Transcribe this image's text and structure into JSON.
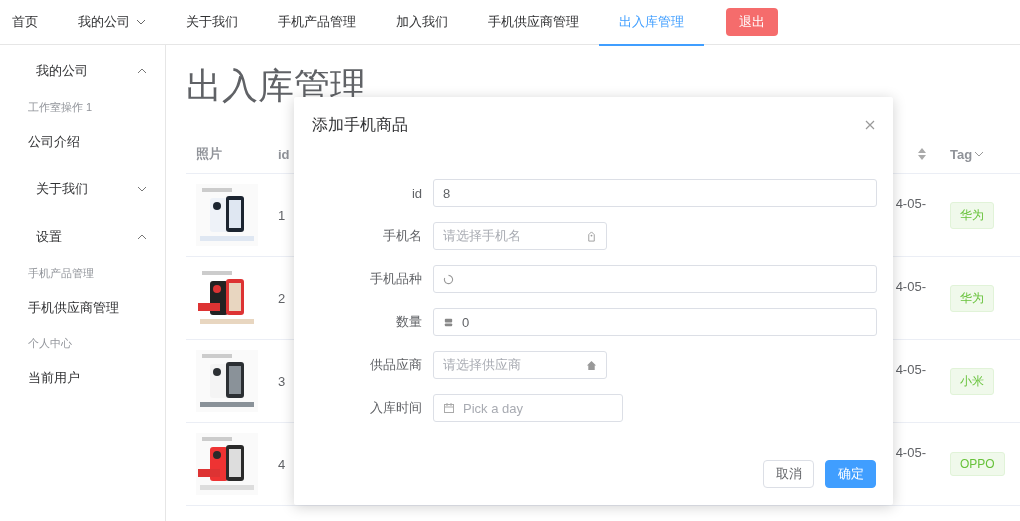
{
  "nav": {
    "items": [
      {
        "label": "首页",
        "selected": false,
        "dropdown": false
      },
      {
        "label": "我的公司",
        "selected": false,
        "dropdown": true
      },
      {
        "label": "关于我们",
        "selected": false,
        "dropdown": false
      },
      {
        "label": "手机产品管理",
        "selected": false,
        "dropdown": false
      },
      {
        "label": "加入我们",
        "selected": false,
        "dropdown": false
      },
      {
        "label": "手机供应商管理",
        "selected": false,
        "dropdown": false
      },
      {
        "label": "出入库管理",
        "selected": true,
        "dropdown": false
      }
    ],
    "logout": "退出"
  },
  "sidebar": {
    "items": [
      {
        "kind": "submenu",
        "label": "我的公司",
        "expanded": true,
        "children": [
          {
            "kind": "group_title",
            "label": "工作室操作 1"
          },
          {
            "kind": "item",
            "label": "公司介绍"
          }
        ]
      },
      {
        "kind": "submenu",
        "label": "关于我们",
        "expanded": false
      },
      {
        "kind": "submenu",
        "label": "设置",
        "expanded": true,
        "children": [
          {
            "kind": "group_title",
            "label": "手机产品管理"
          },
          {
            "kind": "item",
            "label": "手机供应商管理"
          },
          {
            "kind": "group_title",
            "label": "个人中心"
          },
          {
            "kind": "item",
            "label": "当前用户"
          }
        ]
      }
    ]
  },
  "page_title": "出入库管理",
  "table": {
    "columns": [
      "照片",
      "id",
      "Tag"
    ],
    "rows": [
      {
        "id": "1",
        "date": "4-05-",
        "tag": "华为"
      },
      {
        "id": "2",
        "date": "4-05-",
        "tag": "华为"
      },
      {
        "id": "3",
        "date": "4-05-",
        "tag": "小米"
      },
      {
        "id": "4",
        "date": "4-05-",
        "tag": "OPPO"
      }
    ]
  },
  "dialog": {
    "title": "添加手机商品",
    "fields": [
      {
        "label": "id",
        "value": "8"
      },
      {
        "label": "手机名",
        "placeholder": "请选择手机名"
      },
      {
        "label": "手机品种"
      },
      {
        "label": "数量",
        "value": "0"
      },
      {
        "label": "供品应商",
        "placeholder": "请选择供应商"
      },
      {
        "label": "入库时间",
        "placeholder": "Pick a day"
      }
    ],
    "buttons": [
      {
        "label": "取消",
        "kind": "default"
      },
      {
        "label": "确定",
        "kind": "primary"
      }
    ]
  }
}
